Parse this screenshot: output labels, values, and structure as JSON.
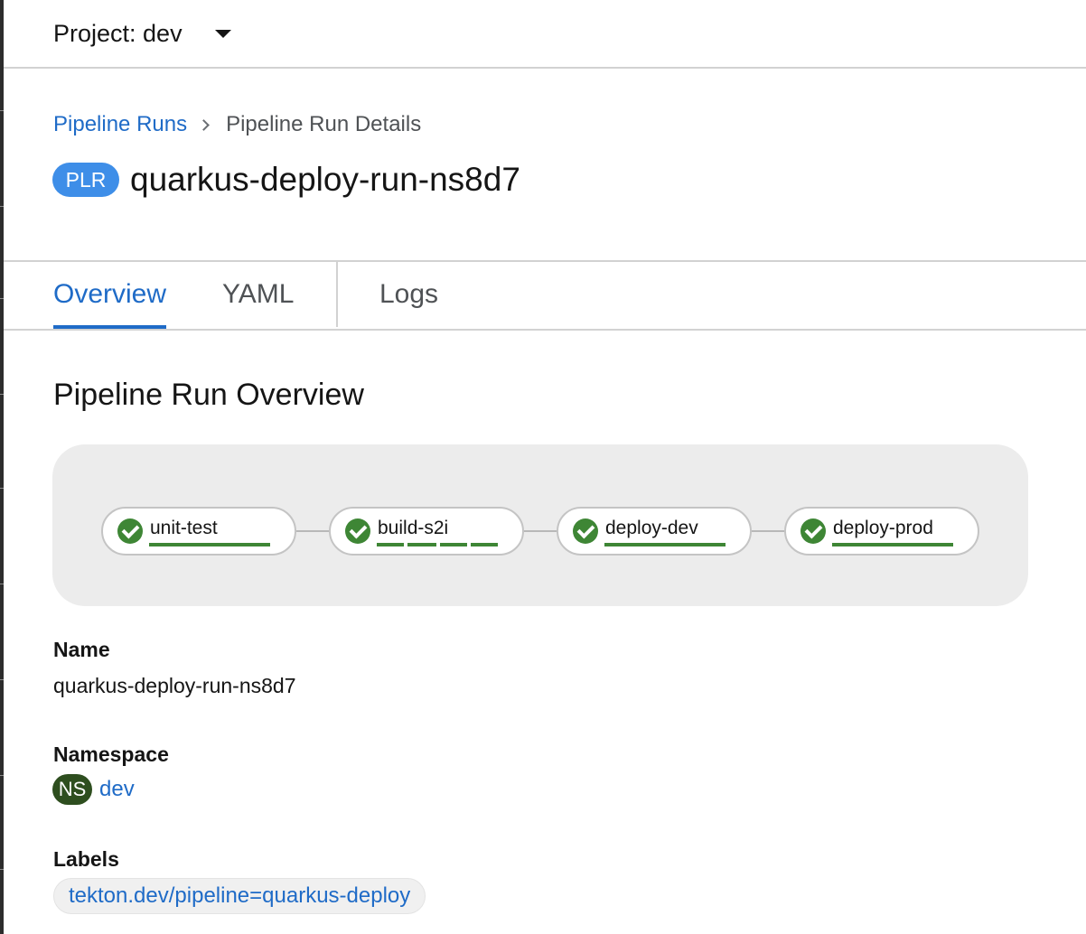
{
  "project": {
    "label": "Project: dev",
    "dropdown_icon": "caret-down-icon"
  },
  "breadcrumb": {
    "parent": "Pipeline Runs",
    "current": "Pipeline Run Details",
    "separator_icon": "chevron-right-icon"
  },
  "header": {
    "badge": "PLR",
    "badge_color": "#3e8ee8",
    "title": "quarkus-deploy-run-ns8d7"
  },
  "tabs": [
    {
      "label": "Overview",
      "active": true
    },
    {
      "label": "YAML",
      "active": false
    },
    {
      "label": "Logs",
      "active": false
    }
  ],
  "overview": {
    "heading": "Pipeline Run Overview"
  },
  "pipeline": {
    "status_color": "#3e8635",
    "tasks": [
      {
        "name": "unit-test",
        "status": "succeeded",
        "status_icon": "check-circle-icon",
        "steps_completed": 1
      },
      {
        "name": "build-s2i",
        "status": "succeeded",
        "status_icon": "check-circle-icon",
        "steps_completed": 4
      },
      {
        "name": "deploy-dev",
        "status": "succeeded",
        "status_icon": "check-circle-icon",
        "steps_completed": 1
      },
      {
        "name": "deploy-prod",
        "status": "succeeded",
        "status_icon": "check-circle-icon",
        "steps_completed": 1
      }
    ]
  },
  "details": {
    "name_label": "Name",
    "name_value": "quarkus-deploy-run-ns8d7",
    "namespace_label": "Namespace",
    "namespace_badge": "NS",
    "namespace_badge_color": "#2e4e1f",
    "namespace_value": "dev",
    "labels_label": "Labels",
    "labels": [
      "tekton.dev/pipeline=quarkus-deploy"
    ]
  },
  "colors": {
    "link": "#1f6bc7",
    "active_tab": "#1f6bc7",
    "success": "#3e8635"
  }
}
